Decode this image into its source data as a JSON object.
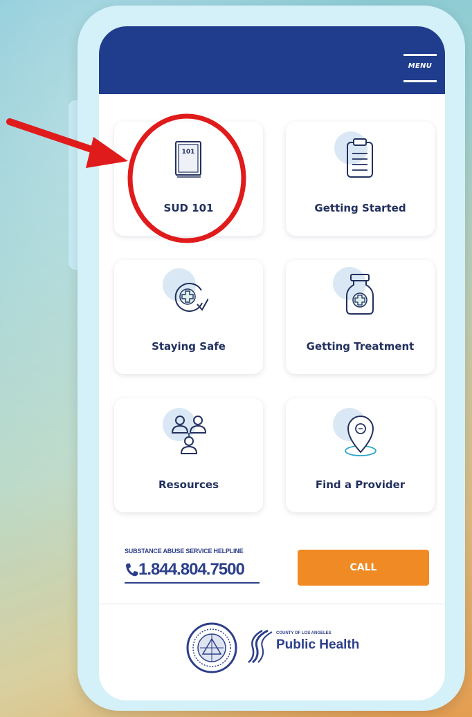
{
  "header": {
    "menu_label": "MENU"
  },
  "tiles": [
    {
      "label": "SUD 101",
      "icon": "book-icon",
      "book_text": "101",
      "highlighted": true
    },
    {
      "label": "Getting Started",
      "icon": "clipboard-icon"
    },
    {
      "label": "Staying Safe",
      "icon": "medical-cycle-icon"
    },
    {
      "label": "Getting Treatment",
      "icon": "medicine-jar-icon"
    },
    {
      "label": "Resources",
      "icon": "people-network-icon"
    },
    {
      "label": "Find a Provider",
      "icon": "location-pin-icon"
    }
  ],
  "helpline": {
    "title": "SUBSTANCE ABUSE SERVICE HELPLINE",
    "number": "1.844.804.7500"
  },
  "call_button": {
    "label": "CALL"
  },
  "footer": {
    "logo_small": "COUNTY OF LOS ANGELES",
    "logo_big": "Public Health"
  },
  "colors": {
    "header": "#1f3d8c",
    "call_button": "#f08a24",
    "annotation": "#e01b1b",
    "text": "#22305e"
  }
}
